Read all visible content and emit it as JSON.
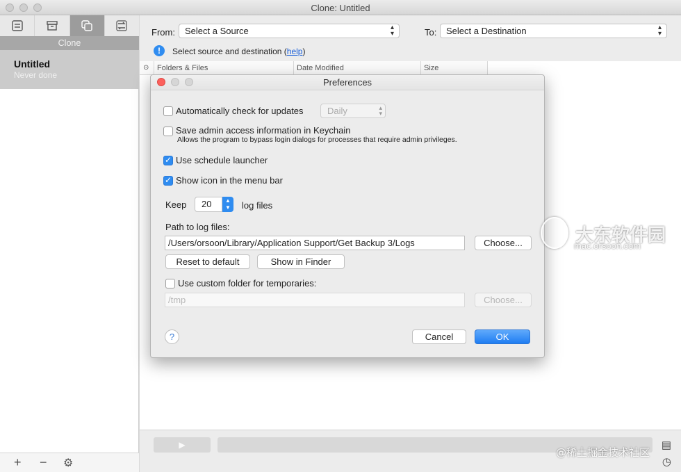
{
  "window": {
    "title": "Clone: Untitled"
  },
  "sidebar": {
    "tabs": [
      {
        "icon": "list-icon"
      },
      {
        "icon": "archive-icon"
      },
      {
        "icon": "clone-icon"
      },
      {
        "icon": "sync-icon"
      }
    ],
    "section_label": "Clone",
    "items": [
      {
        "name": "Untitled",
        "status": "Never done"
      }
    ],
    "bottom": {
      "add": "+",
      "remove": "−",
      "settings": "⚙"
    }
  },
  "main": {
    "from_label": "From:",
    "source_placeholder": "Select a Source",
    "to_label": "To:",
    "destination_placeholder": "Select a Destination",
    "info_text": "Select source and destination (",
    "info_link": "help",
    "info_close": ")",
    "table_headers": [
      "Folders & Files",
      "Date Modified",
      "Size"
    ]
  },
  "dialog": {
    "title": "Preferences",
    "auto_update_label": "Automatically check for updates",
    "auto_update_checked": false,
    "update_frequency": "Daily",
    "keychain_label": "Save admin access information in Keychain",
    "keychain_checked": false,
    "keychain_desc": "Allows the program to bypass login dialogs for processes that require admin privileges.",
    "schedule_label": "Use schedule launcher",
    "schedule_checked": true,
    "menubar_label": "Show icon in the menu bar",
    "menubar_checked": true,
    "keep_label": "Keep",
    "keep_value": "20",
    "log_files_label": "log files",
    "path_label": "Path to log files:",
    "path_value": "/Users/orsoon/Library/Application Support/Get Backup 3/Logs",
    "choose_label": "Choose...",
    "reset_label": "Reset to default",
    "show_finder_label": "Show in Finder",
    "custom_folder_label": "Use custom folder for temporaries:",
    "custom_folder_checked": false,
    "temp_placeholder": "/tmp",
    "choose_disabled_label": "Choose...",
    "help_label": "?",
    "cancel_label": "Cancel",
    "ok_label": "OK"
  },
  "colors": {
    "accent": "#2f8cf0",
    "close_red": "#fc605c"
  },
  "watermarks": {
    "top_right": "大东软件园",
    "top_right_sub": "mac.orsoon.com",
    "bottom_right": "@稀土掘金技术社区"
  }
}
